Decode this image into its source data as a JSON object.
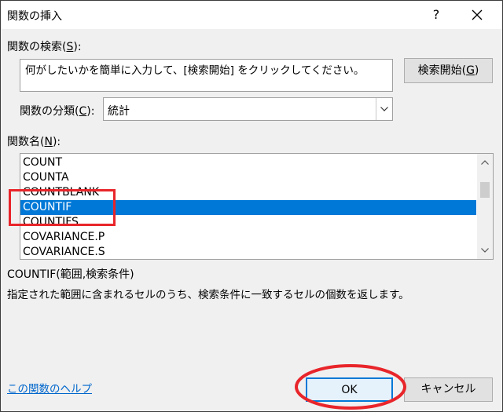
{
  "window": {
    "title": "関数の挿入",
    "help_glyph": "?"
  },
  "search": {
    "label_prefix": "関数の検索(",
    "label_key": "S",
    "label_suffix": "):",
    "text": "何がしたいかを簡単に入力して、[検索開始] をクリックしてください。",
    "button_prefix": "検索開始(",
    "button_key": "G",
    "button_suffix": ")"
  },
  "category": {
    "label_prefix": "関数の分類(",
    "label_key": "C",
    "label_suffix": "):",
    "value": "統計"
  },
  "function_list": {
    "label_prefix": "関数名(",
    "label_key": "N",
    "label_suffix": "):",
    "items": [
      "COUNT",
      "COUNTA",
      "COUNTBLANK",
      "COUNTIF",
      "COUNTIFS",
      "COVARIANCE.P",
      "COVARIANCE.S"
    ],
    "selected": "COUNTIF"
  },
  "selected_function": {
    "syntax": "COUNTIF(範囲,検索条件)",
    "description": "指定された範囲に含まれるセルのうち、検索条件に一致するセルの個数を返します。"
  },
  "footer": {
    "help_link": "この関数のヘルプ",
    "ok_label": "OK",
    "cancel_label": "キャンセル"
  },
  "annotations": {
    "color": "#e8252a"
  },
  "colors": {
    "selection": "#0078d7",
    "link": "#0066cc"
  }
}
